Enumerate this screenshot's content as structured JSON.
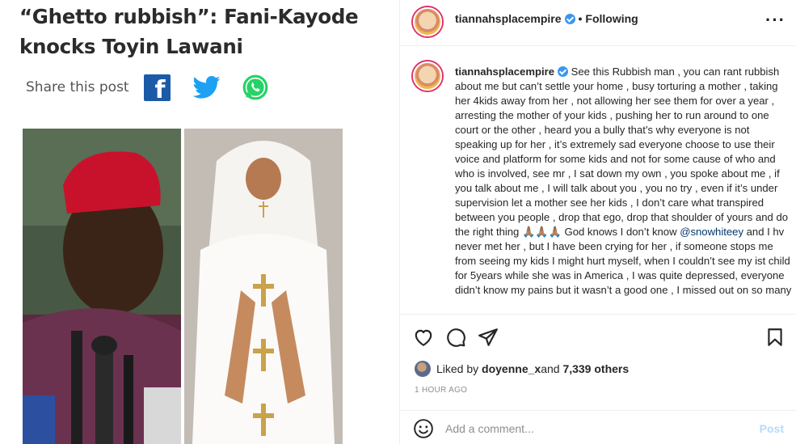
{
  "article": {
    "headline": "“Ghetto rubbish”: Fani-Kayode knocks Toyin Lawani",
    "share_label": "Share this post"
  },
  "post": {
    "username": "tiannahsplacempire",
    "dot": "•",
    "following_label": "Following",
    "more_label": "···",
    "caption_part1": " See this Rubbish man , you can rant rubbish about me but can’t settle your home , busy torturing a mother , taking her 4kids away from her , not allowing her see them for over a year , arresting the mother of your kids , pushing her to run around to one court or the other , heard you a bully that’s why everyone is not speaking up for her , it’s extremely sad everyone choose to use their voice and platform for some kids and not for some cause of who and who is involved, see mr , I sat down my own , you spoke about me , if you talk about me , I will talk about you , you no try , even if it’s under supervision let a mother see her kids , I don’t care what transpired between you people , drop that ego, drop that shoulder of yours and do the right thing 🙏🏽🙏🏽🙏🏽 God knows I don’t know ",
    "mention": "@snowhiteey",
    "caption_part2": " and I hv never met her , but I have been crying for her , if someone stops me from seeing my kids I might hurt myself, when I couldn’t see my ist child for 5years while she was in America , I was quite depressed, everyone didn’t know my pains but it wasn’t a good one , I missed out on so many",
    "liked_by_prefix": "Liked by ",
    "liked_by_user": "doyenne_x",
    "liked_by_and": " and ",
    "liked_by_others": "7,339 others",
    "timestamp": "1 HOUR AGO",
    "comment_placeholder": "Add a comment...",
    "post_label": "Post"
  },
  "colors": {
    "facebook": "#1b5aa6",
    "twitter": "#1da1f2",
    "whatsapp": "#25d366",
    "verified": "#3897f0",
    "mention": "#00376b",
    "post_button": "#b3dbff"
  },
  "icons": {
    "facebook": "facebook-icon",
    "twitter": "twitter-icon",
    "whatsapp": "whatsapp-icon",
    "verified": "verified-badge-icon",
    "more": "more-options-icon",
    "heart": "heart-icon",
    "comment": "comment-icon",
    "share": "share-icon",
    "save": "bookmark-icon",
    "emoji": "emoji-icon"
  }
}
